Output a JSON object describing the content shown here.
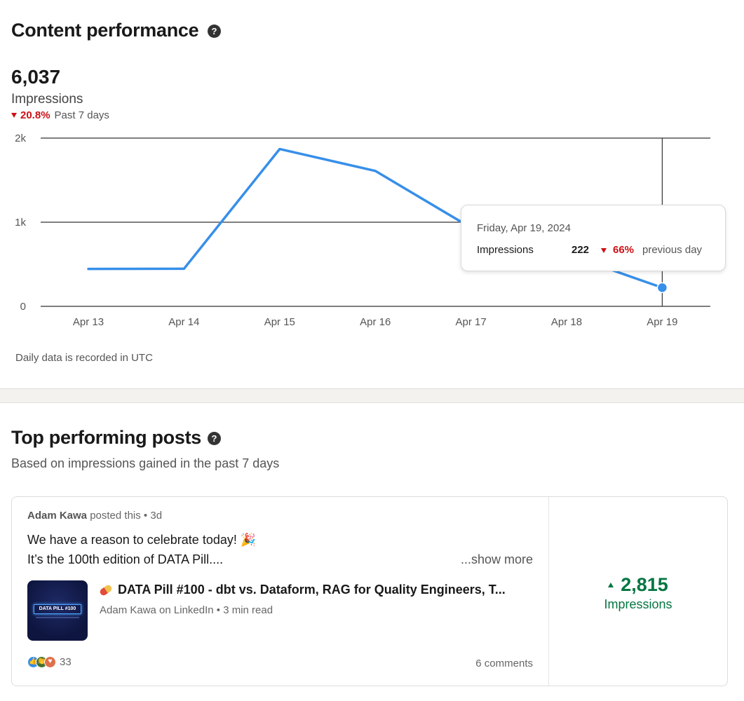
{
  "content_performance": {
    "title": "Content performance",
    "help_icon": "question-circle-icon",
    "total": "6,037",
    "metric": "Impressions",
    "change_pct": "20.8%",
    "change_period": "Past 7 days",
    "footnote": "Daily data is recorded in UTC",
    "tooltip": {
      "date": "Friday, Apr 19, 2024",
      "label": "Impressions",
      "value": "222",
      "change_pct": "66%",
      "change_suffix": "previous day"
    }
  },
  "chart_data": {
    "type": "line",
    "categories": [
      "Apr 13",
      "Apr 14",
      "Apr 15",
      "Apr 16",
      "Apr 17",
      "Apr 18",
      "Apr 19"
    ],
    "series": [
      {
        "values": [
          445,
          447,
          1870,
          1610,
          935,
          620,
          222
        ]
      }
    ],
    "y_ticks": [
      "0",
      "1k",
      "2k"
    ],
    "ylim": [
      0,
      2000
    ],
    "highlighted_index": 6,
    "grid": true,
    "line_color": "#378fe9"
  },
  "top_posts": {
    "title": "Top performing posts",
    "help_icon": "question-circle-icon",
    "subtitle": "Based on impressions gained in the past 7 days",
    "post": {
      "author": "Adam Kawa",
      "action": "posted this",
      "separator": "•",
      "age": "3d",
      "line1": "We have a reason to celebrate today! 🎉",
      "line2": "It’s the 100th edition of DATA Pill....",
      "show_more": "...show more",
      "thumbnail_text": "DATA PILL #100",
      "article_title": "DATA Pill #100 - dbt vs. Dataform, RAG for Quality Engineers, T...",
      "article_source": "Adam Kawa on LinkedIn • 3 min read",
      "reactions_count": "33",
      "comments": "6 comments",
      "impressions_value": "2,815",
      "impressions_label": "Impressions"
    }
  },
  "colors": {
    "accent_blue": "#378fe9",
    "negative": "#cc1016",
    "positive": "#057642"
  }
}
